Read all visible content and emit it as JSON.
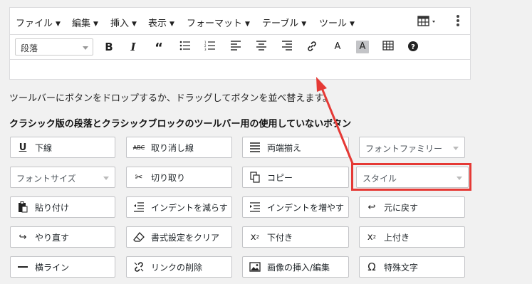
{
  "menubar": {
    "items": [
      "ファイル",
      "編集",
      "挿入",
      "表示",
      "フォーマット",
      "テーブル",
      "ツール"
    ]
  },
  "toolbar": {
    "format_select": "段落",
    "icons": [
      "bold-icon",
      "italic-icon",
      "blockquote-icon",
      "bullet-list-icon",
      "numbered-list-icon",
      "align-left-icon",
      "align-center-icon",
      "align-right-icon",
      "link-icon",
      "text-color-icon",
      "background-color-icon",
      "table-icon",
      "help-icon"
    ]
  },
  "hint": "ツールバーにボタンをドロップするか、ドラッグしてボタンを並べ替えます。",
  "heading": "クラシック版の段落とクラシックブロックのツールバー用の使用していないボタン",
  "buttons": {
    "underline": "下線",
    "strikethrough": "取り消し線",
    "justify": "両端揃え",
    "font_family": "フォントファミリー",
    "font_size": "フォントサイズ",
    "cut": "切り取り",
    "copy": "コピー",
    "style": "スタイル",
    "paste": "貼り付け",
    "outdent": "インデントを減らす",
    "indent": "インデントを増やす",
    "undo": "元に戻す",
    "redo": "やり直す",
    "clear_formatting": "書式設定をクリア",
    "subscript": "下付き",
    "superscript": "上付き",
    "hr": "横ライン",
    "unlink": "リンクの削除",
    "image": "画像の挿入/編集",
    "special_char": "特殊文字"
  },
  "colors": {
    "highlight": "#e53935",
    "arrow": "#e53935"
  }
}
